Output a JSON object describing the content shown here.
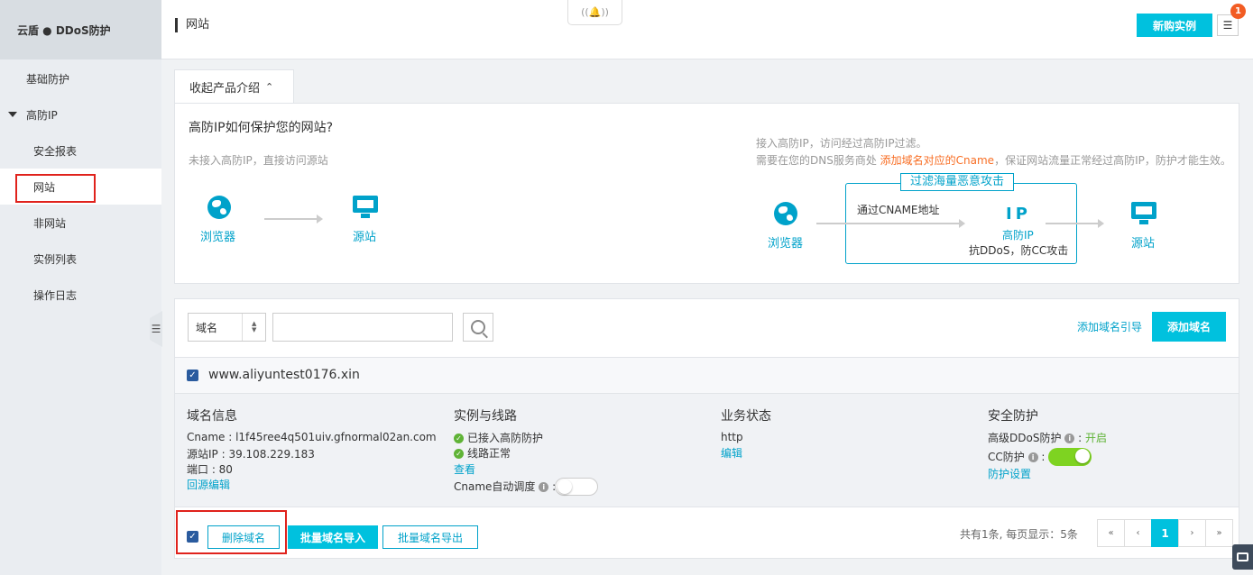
{
  "sidebar": {
    "title": "云盾 ● DDoS防护",
    "items": [
      {
        "label": "基础防护"
      },
      {
        "label": "高防IP"
      },
      {
        "label": "安全报表"
      },
      {
        "label": "网站"
      },
      {
        "label": "非网站"
      },
      {
        "label": "实例列表"
      },
      {
        "label": "操作日志"
      }
    ],
    "collapse_icon": "☰"
  },
  "header": {
    "title": "网站",
    "buy_button": "新购实例",
    "badge_count": "1",
    "menu_icon": "☰",
    "bell_icon": "((🔔))"
  },
  "intro": {
    "tab_label": "收起产品介绍",
    "tab_caret": "⌃",
    "heading": "高防IP如何保护您的网站?",
    "left_subtitle": "未接入高防IP，直接访问源站",
    "right_line1": "接入高防IP，访问经过高防IP过滤。",
    "right_line2_prefix": "需要在您的DNS服务商处 ",
    "right_line2_link": "添加域名对应的Cname",
    "right_line2_suffix": "，保证网站流量正常经过高防IP，防护才能生效。",
    "browser_label": "浏览器",
    "origin_label": "源站",
    "filter_label": "过滤海量恶意攻击",
    "cname_label": "通过CNAME地址",
    "ip_big": "IP",
    "ip_label": "高防IP",
    "ip_desc": "抗DDoS，防CC攻击"
  },
  "toolbar": {
    "select_value": "域名",
    "select_arrows": [
      "▲",
      "▼"
    ],
    "search_placeholder": "",
    "guide_link": "添加域名引导",
    "add_button": "添加域名"
  },
  "domain": {
    "name": "www.aliyuntest0176.xin",
    "checked_mark": "✓",
    "info": {
      "title": "域名信息",
      "cname": "Cname : l1f45ree4q501uiv.gfnormal02an.com",
      "origin_ip": "源站IP : 39.108.229.183",
      "port": "端口 : 80",
      "edit_link": "回源编辑"
    },
    "instance": {
      "title": "实例与线路",
      "status1": "已接入高防防护",
      "status2": "线路正常",
      "view_link": "查看",
      "cname_auto": "Cname自动调度",
      "cname_auto_on": false
    },
    "business": {
      "title": "业务状态",
      "protocol": "http",
      "edit_link": "编辑"
    },
    "security": {
      "title": "安全防护",
      "ddos_label": "高级DDoS防护",
      "ddos_status": "开启",
      "cc_label": "CC防护",
      "cc_on": true,
      "settings_link": "防护设置"
    }
  },
  "footer": {
    "delete_button": "删除域名",
    "import_button": "批量域名导入",
    "export_button": "批量域名导出",
    "summary": "共有1条,  每页显示：5条",
    "pager": {
      "first": "«",
      "prev": "‹",
      "current": "1",
      "next": "›",
      "last": "»"
    }
  },
  "colors": {
    "accent": "#00c1de",
    "link": "#00a2ca",
    "highlight_border": "#e0221c",
    "success": "#5fb336",
    "toggle_on": "#7ed321",
    "warning": "#f86e24"
  }
}
